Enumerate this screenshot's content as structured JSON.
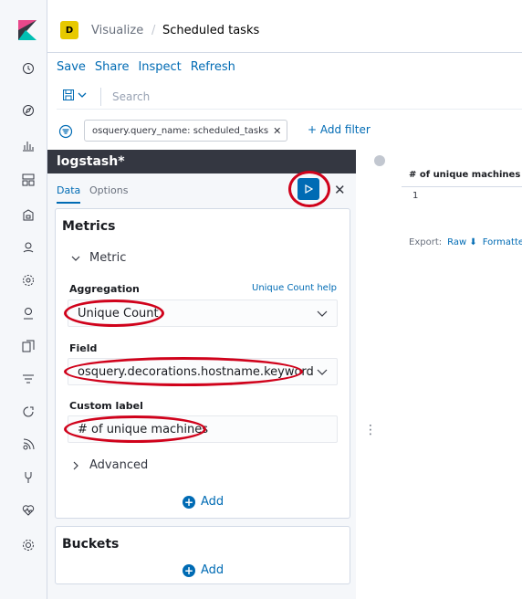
{
  "header": {
    "space_initial": "D",
    "breadcrumb_parent": "Visualize",
    "breadcrumb_separator": "/",
    "breadcrumb_current": "Scheduled tasks"
  },
  "top_menu": [
    {
      "label": "Save"
    },
    {
      "label": "Share"
    },
    {
      "label": "Inspect"
    },
    {
      "label": "Refresh"
    }
  ],
  "search": {
    "placeholder": "Search",
    "value": ""
  },
  "filters": {
    "pill_label": "osquery.query_name: scheduled_tasks",
    "add_filter_label": "+ Add filter"
  },
  "sidebar": {
    "index_pattern": "logstash*",
    "tabs": [
      "Data",
      "Options"
    ],
    "active_tab": "Data"
  },
  "metrics": {
    "title": "Metrics",
    "section_label": "Metric",
    "aggregation_label": "Aggregation",
    "aggregation_help": "Unique Count help",
    "aggregation_value": "Unique Count",
    "field_label": "Field",
    "field_value": "osquery.decorations.hostname.keyword",
    "custom_label_label": "Custom label",
    "custom_label_value": "# of unique machines",
    "advanced_label": "Advanced",
    "add_label": "Add"
  },
  "buckets": {
    "title": "Buckets",
    "add_label": "Add"
  },
  "results": {
    "column_header": "# of unique machines",
    "rows": [
      "1"
    ],
    "export_label": "Export:",
    "export_raw": "Raw",
    "export_formatted": "Formatted"
  },
  "colors": {
    "accent": "#006bb4",
    "annotation": "#d0021b",
    "nav_background": "#f5f7fa",
    "sidebar_title_bg": "#343741"
  }
}
